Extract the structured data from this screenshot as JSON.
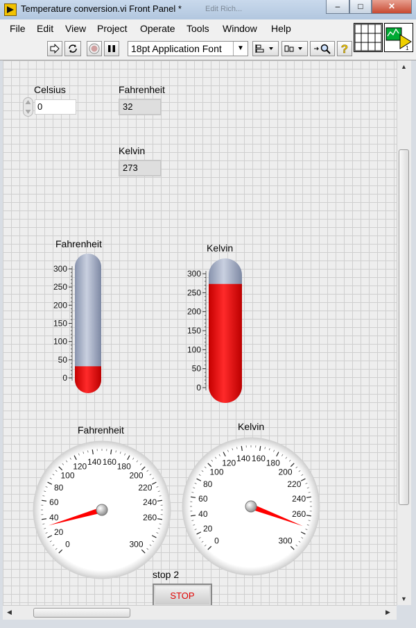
{
  "window": {
    "title": "Temperature conversion.vi Front Panel *",
    "background_tab": "Edit Rich..."
  },
  "menu": {
    "items": [
      "File",
      "Edit",
      "View",
      "Project",
      "Operate",
      "Tools",
      "Window",
      "Help"
    ]
  },
  "toolbar": {
    "font_ring_value": "18pt Application Font"
  },
  "panel": {
    "celsius": {
      "label": "Celsius",
      "value": "0"
    },
    "fahrenheit_indicator": {
      "label": "Fahrenheit",
      "value": "32"
    },
    "kelvin_indicator": {
      "label": "Kelvin",
      "value": "273"
    },
    "fahrenheit_thermometer": {
      "label": "Fahrenheit",
      "ticks": [
        "300",
        "250",
        "200",
        "150",
        "100",
        "50",
        "0"
      ],
      "value": 32,
      "min": 0,
      "max": 300,
      "fill_color": "#ff0000",
      "empty_color": "#a9b4cc"
    },
    "kelvin_thermometer": {
      "label": "Kelvin",
      "ticks": [
        "300",
        "250",
        "200",
        "150",
        "100",
        "50",
        "0"
      ],
      "value": 273,
      "min": 0,
      "max": 300,
      "fill_color": "#ff0000",
      "empty_color": "#a9b4cc"
    },
    "fahrenheit_gauge": {
      "label": "Fahrenheit",
      "ticks": [
        "0",
        "20",
        "40",
        "60",
        "80",
        "100",
        "120",
        "140",
        "160",
        "180",
        "200",
        "220",
        "240",
        "260",
        "300"
      ],
      "value": 32,
      "min": 0,
      "max": 300,
      "needle_color": "#ff0000"
    },
    "kelvin_gauge": {
      "label": "Kelvin",
      "ticks": [
        "0",
        "20",
        "40",
        "60",
        "80",
        "100",
        "120",
        "140",
        "160",
        "180",
        "200",
        "220",
        "240",
        "260",
        "300"
      ],
      "value": 273,
      "min": 0,
      "max": 300,
      "needle_color": "#ff0000"
    },
    "stop": {
      "label": "stop 2",
      "button_text": "STOP",
      "text_color": "#e00000"
    }
  },
  "colors": {
    "window_title_bg": "#c9d9ec",
    "panel_grid": "#cfcfcf",
    "panel_bg": "#eeeeee"
  }
}
